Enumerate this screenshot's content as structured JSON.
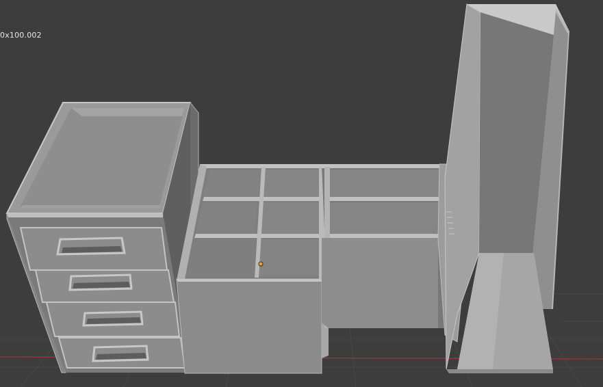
{
  "viewport": {
    "overlay_text": "0x100.002",
    "background_color": "#3d3d3d",
    "grid_color": "#4a4a4a",
    "axis_color": "#8a3a3a",
    "origin_color": "#e8a34a"
  },
  "objects": [
    {
      "name": "drawer-cabinet",
      "drawers": 4
    },
    {
      "name": "cubby-shelf",
      "compartments": 6
    },
    {
      "name": "shelf-unit",
      "compartments": 4
    },
    {
      "name": "tall-wardrobe-panel"
    }
  ]
}
